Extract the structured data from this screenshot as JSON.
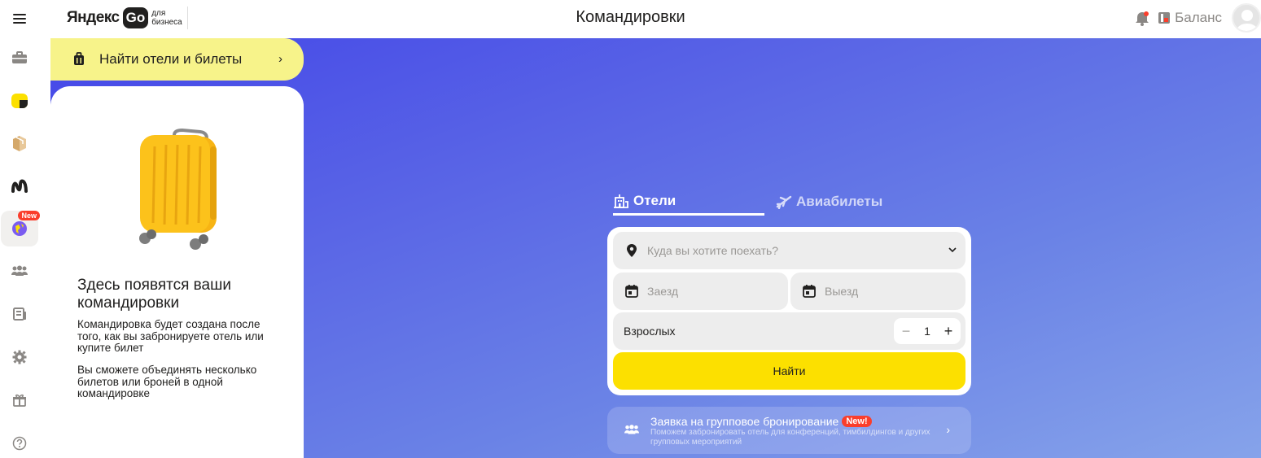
{
  "header": {
    "logo_text": "Яндекс",
    "logo_go": "Go",
    "logo_sub_1": "для",
    "logo_sub_2": "бизнеса",
    "page_title": "Командировки",
    "balance_label": "Баланс"
  },
  "sidebar": {
    "items": [
      {
        "name": "trips-icon",
        "active": false
      },
      {
        "name": "eats-icon",
        "active": false
      },
      {
        "name": "delivery-icon",
        "active": false
      },
      {
        "name": "market-icon",
        "active": false
      },
      {
        "name": "travel-icon",
        "active": true,
        "badge": "New"
      },
      {
        "name": "employees-icon",
        "active": false
      },
      {
        "name": "reports-icon",
        "active": false
      },
      {
        "name": "settings-icon",
        "active": false
      },
      {
        "name": "gift-icon",
        "active": false
      },
      {
        "name": "help-icon",
        "active": false
      }
    ]
  },
  "left_panel": {
    "find_label": "Найти отели и билеты",
    "empty_title": "Здесь появятся ваши командировки",
    "empty_p1": "Командировка будет создана после того, как вы забронируете отель или купите билет",
    "empty_p2": "Вы сможете объединять несколько билетов или броней в одной командировке"
  },
  "tabs": {
    "hotels": "Отели",
    "avia": "Авиабилеты"
  },
  "search": {
    "destination_placeholder": "Куда вы хотите поехать?",
    "checkin_placeholder": "Заезд",
    "checkout_placeholder": "Выезд",
    "adults_label": "Взрослых",
    "adults_value": "1",
    "submit_label": "Найти"
  },
  "group_booking": {
    "title": "Заявка на групповое бронирование",
    "badge": "New!",
    "subtitle": "Поможем забронировать отель для конференций, тимбилдингов и других групповых мероприятий"
  },
  "colors": {
    "accent_yellow": "#fce000",
    "find_bar": "#f7f38a",
    "hero_top": "#4447e8",
    "hero_bottom": "#86a3ea",
    "badge_red": "#fa3e2c"
  }
}
